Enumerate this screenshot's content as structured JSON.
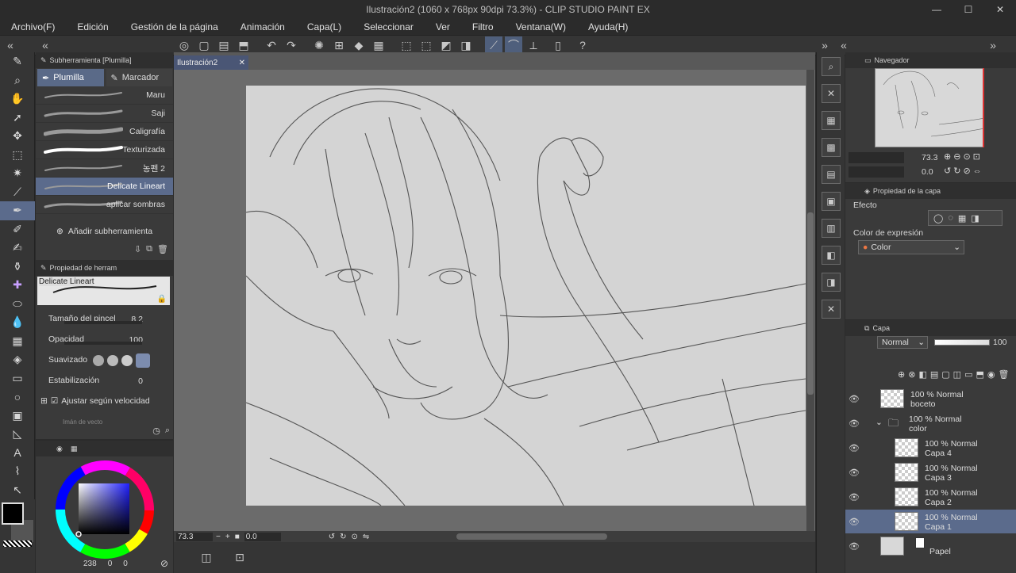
{
  "window": {
    "title": "Ilustración2 (1060 x 768px 90dpi 73.3%) - CLIP STUDIO PAINT EX",
    "minimize": "—",
    "maximize": "☐",
    "close": "✕"
  },
  "menu": [
    "Archivo(F)",
    "Edición",
    "Gestión de la página",
    "Animación",
    "Capa(L)",
    "Seleccionar",
    "Ver",
    "Filtro",
    "Ventana(W)",
    "Ayuda(H)"
  ],
  "subtool": {
    "header": "Subherramienta [Plumilla]",
    "tabs": [
      "Plumilla",
      "Marcador"
    ],
    "brushes": [
      "Maru",
      "Saji",
      "Caligrafía",
      "Texturizada",
      "농펜 2",
      "Delicate Lineart",
      "aplicar sombras"
    ],
    "selected_index": 5,
    "add_label": "Añadir subherramienta"
  },
  "toolprop": {
    "header": "Propiedad de herram",
    "preview_label": "Delicate Lineart",
    "brush_size_label": "Tamaño del pincel",
    "brush_size_value": "8.2",
    "opacity_label": "Opacidad",
    "opacity_value": "100",
    "smoothing_label": "Suavizado",
    "stabilization_label": "Estabilización",
    "stabilization_value": "0",
    "speed_label": "Ajustar según velocidad",
    "vector_label": "Imán de vecto"
  },
  "color": {
    "main": "#000000",
    "sub": "#ffffff",
    "accent": "#5b6b8c",
    "value_238": "238",
    "value_0a": "0",
    "value_0b": "0"
  },
  "canvas": {
    "tab_label": "Ilustración2",
    "zoom": "73.3",
    "rotation": "0.0"
  },
  "navigator": {
    "header": "Navegador",
    "zoom": "73.3",
    "angle": "0.0"
  },
  "layerprop": {
    "header": "Propiedad de la capa",
    "effect_label": "Efecto",
    "expression_label": "Color de expresión",
    "expression_value": "Color"
  },
  "layers": {
    "header": "Capa",
    "blend_mode": "Normal",
    "opacity": "100",
    "items": [
      {
        "mode": "100 % Normal",
        "name": "boceto"
      },
      {
        "mode": "100 % Normal",
        "name": "color"
      },
      {
        "mode": "100 % Normal",
        "name": "Capa 4"
      },
      {
        "mode": "100 % Normal",
        "name": "Capa 3"
      },
      {
        "mode": "100 % Normal",
        "name": "Capa 2"
      },
      {
        "mode": "100 % Normal",
        "name": "Capa 1"
      },
      {
        "mode": "",
        "name": "Papel"
      }
    ]
  }
}
